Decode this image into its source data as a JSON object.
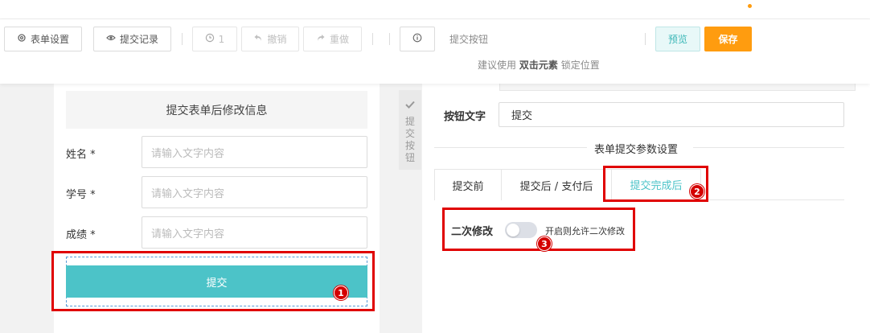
{
  "toolbar": {
    "form_settings": "表单设置",
    "submit_records": "提交记录",
    "history_count": "1",
    "undo": "撤销",
    "redo": "重做",
    "selected_component": "提交按钮",
    "hint_prefix": "建议使用",
    "hint_bold": "双击元素",
    "hint_suffix": "锁定位置",
    "preview": "预览",
    "save": "保存"
  },
  "form": {
    "header": "提交表单后修改信息",
    "fields": [
      {
        "label": "姓名 *",
        "placeholder": "请输入文字内容"
      },
      {
        "label": "学号 *",
        "placeholder": "请输入文字内容"
      },
      {
        "label": "成绩 *",
        "placeholder": "请输入文字内容"
      }
    ],
    "submit": "提交"
  },
  "side_tab": {
    "label": "提交按钮"
  },
  "settings": {
    "button_text_label": "按钮文字",
    "button_text_value": "提交",
    "section_title": "表单提交参数设置",
    "tabs": [
      "提交前",
      "提交后 / 支付后",
      "提交完成后"
    ],
    "active_tab": "提交完成后",
    "toggle_label": "二次修改",
    "toggle_on": false,
    "toggle_hint": "开启则允许二次修改"
  },
  "annotations": {
    "badge_1": "1",
    "badge_2": "2",
    "badge_3": "3"
  },
  "colors": {
    "accent": "#4cc3c8",
    "save": "#ff9c0f",
    "annotation": "#e00000"
  }
}
